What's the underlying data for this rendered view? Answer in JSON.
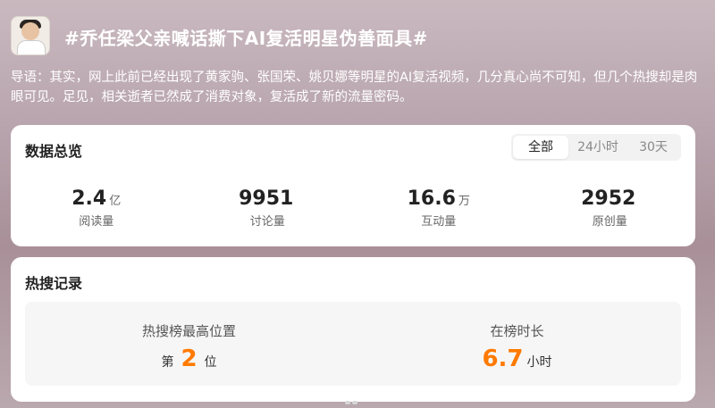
{
  "header": {
    "title": "#乔任梁父亲喊话撕下AI复活明星伪善面具#",
    "intro": "导语：其实，网上此前已经出现了黄家驹、张国荣、姚贝娜等明星的AI复活视频，几分真心尚不可知，但几个热搜却是肉眼可见。足见，相关逝者已然成了消费对象，复活成了新的流量密码。"
  },
  "overview": {
    "title": "数据总览",
    "tabs": [
      "全部",
      "24小时",
      "30天"
    ],
    "active_tab": "全部",
    "stats": [
      {
        "value": "2.4",
        "unit": "亿",
        "label": "阅读量"
      },
      {
        "value": "9951",
        "unit": "",
        "label": "讨论量"
      },
      {
        "value": "16.6",
        "unit": "万",
        "label": "互动量"
      },
      {
        "value": "2952",
        "unit": "",
        "label": "原创量"
      }
    ]
  },
  "hot_search": {
    "title": "热搜记录",
    "highest_caption": "热搜榜最高位置",
    "highest_prefix": "第",
    "highest_value": "2",
    "highest_suffix": "位",
    "duration_caption": "在榜时长",
    "duration_value": "6.7",
    "duration_unit": "小时"
  },
  "colors": {
    "accent": "#ff7a00"
  }
}
